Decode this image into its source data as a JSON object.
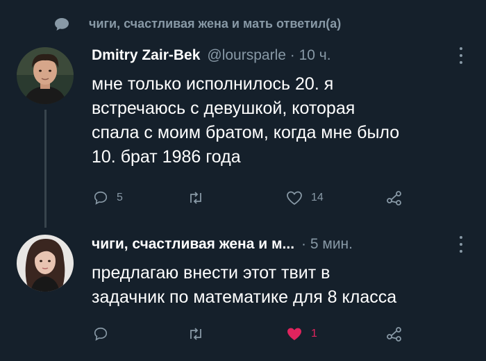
{
  "context": {
    "text": "чиги, счастливая жена и мать ответил(а)",
    "icon": "chat-bubble-icon"
  },
  "tweets": [
    {
      "name": "Dmitry Zair-Bek",
      "meta": "@loursparle · 10 ч.",
      "text": "мне только исполнилось 20. я\nвстречаюсь с девушкой, которая\nспала с моим братом, когда мне было\n10. брат 1986 года",
      "actions": {
        "reply_count": "5",
        "retweet_count": "",
        "like_count": "14"
      }
    },
    {
      "name": "чиги, счастливая жена и м...",
      "meta": "· 5 мин.",
      "text": "предлагаю внести этот твит в\nзадачник по математике для 8 класса",
      "actions": {
        "reply_count": "",
        "retweet_count": "",
        "like_count": "1",
        "liked": true
      }
    }
  ],
  "colors": {
    "background": "#15202b",
    "secondary_text": "#8899a6",
    "like": "#e0245e",
    "thread_line": "#38444d"
  }
}
